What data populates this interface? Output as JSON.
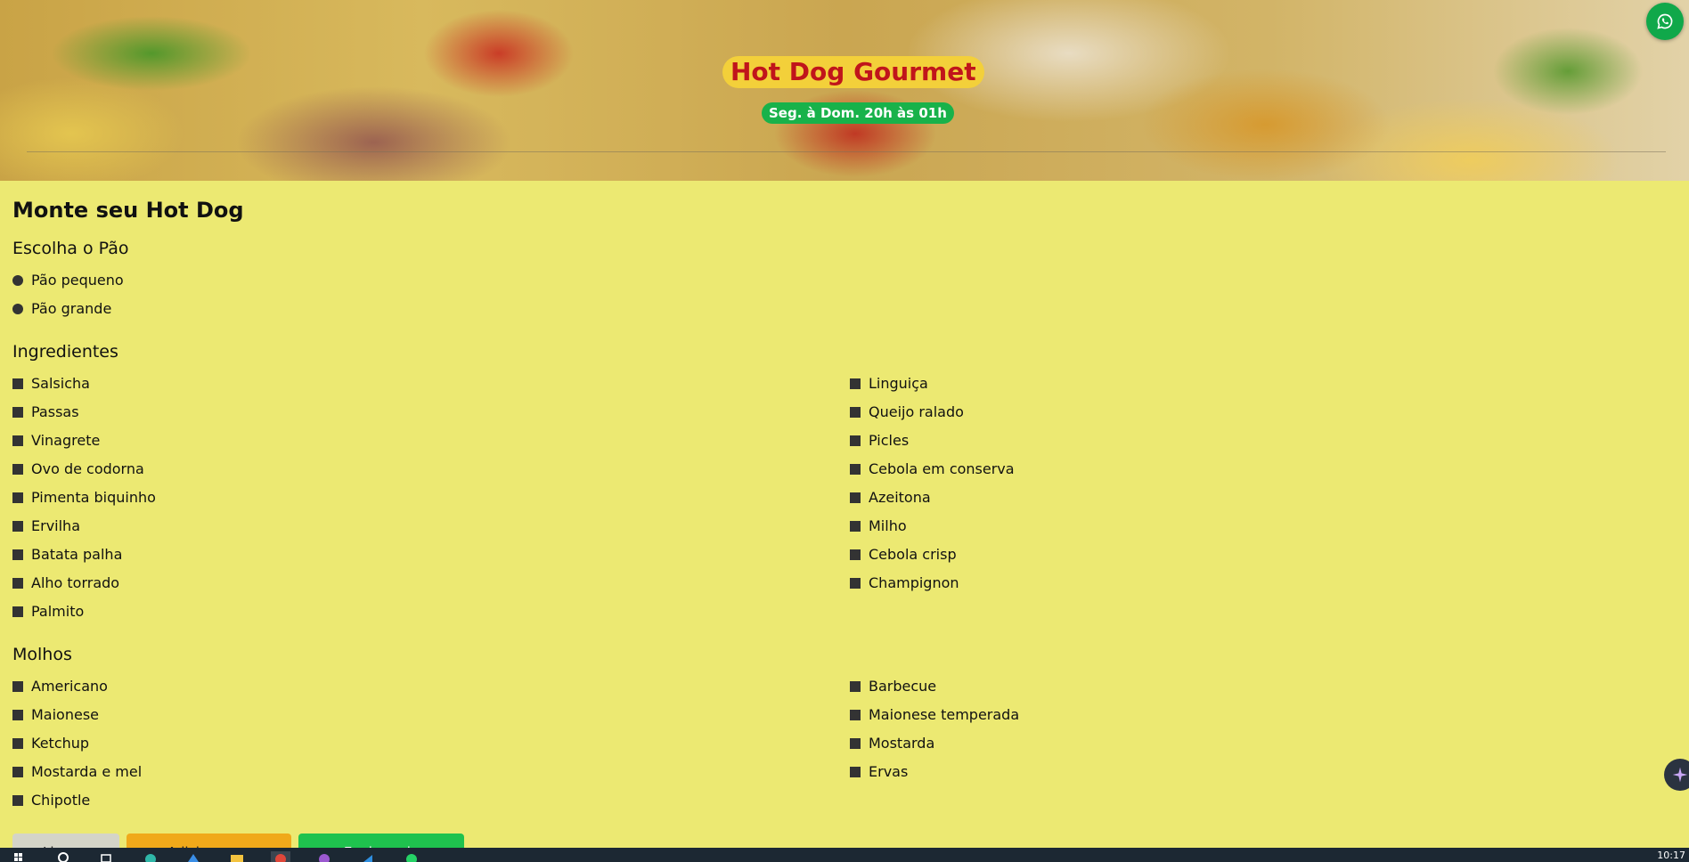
{
  "hero": {
    "title": "Hot Dog Gourmet",
    "hours": "Seg. à Dom. 20h às 01h"
  },
  "page_title": "Monte seu Hot Dog",
  "bread": {
    "title": "Escolha o Pão",
    "options": [
      "Pão pequeno",
      "Pão grande"
    ]
  },
  "ingredients": {
    "title": "Ingredientes",
    "items": [
      "Salsicha",
      "Linguiça",
      "Passas",
      "Queijo ralado",
      "Vinagrete",
      "Picles",
      "Ovo de codorna",
      "Cebola em conserva",
      "Pimenta biquinho",
      "Azeitona",
      "Ervilha",
      "Milho",
      "Batata palha",
      "Cebola crisp",
      "Alho torrado",
      "Champignon",
      "Palmito"
    ]
  },
  "sauces": {
    "title": "Molhos",
    "items": [
      "Americano",
      "Barbecue",
      "Maionese",
      "Maionese temperada",
      "Ketchup",
      "Mostarda",
      "Mostarda e mel",
      "Ervas",
      "Chipotle"
    ]
  },
  "buttons": {
    "clear": "Limpar Tudo",
    "add": "Adicionar ao Carrinho",
    "whatsapp": "Enviar pelo WhatsApp"
  },
  "taskbar": {
    "clock": "10:17"
  },
  "icons": {
    "whatsapp_float": "whatsapp-icon",
    "copilot_float": "sparkle-icon"
  },
  "colors": {
    "background": "#ece972",
    "title_bg": "#f3d03a",
    "title_text": "#c0151b",
    "hours_bg": "#18b24a",
    "whatsapp": "#10a84a",
    "add_button": "#f0a91a",
    "whatsapp_button": "#1fc24e"
  }
}
